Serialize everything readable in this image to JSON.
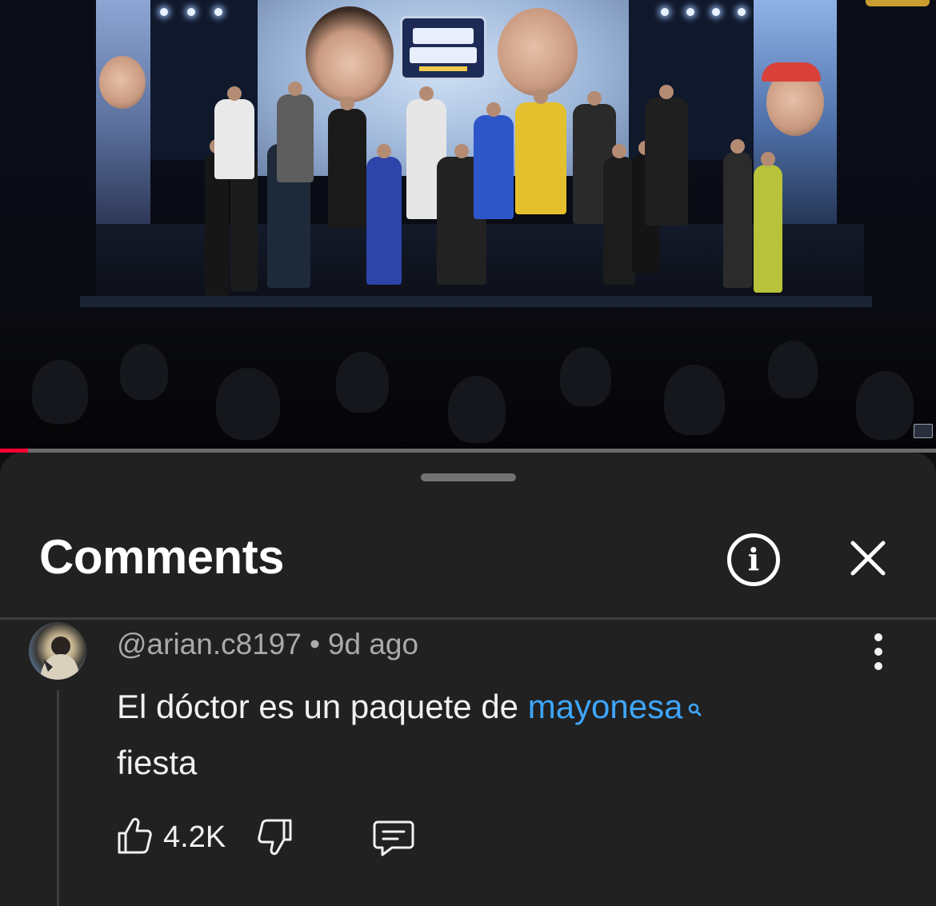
{
  "video": {
    "progress_fraction": 0.03
  },
  "comments_panel": {
    "title": "Comments",
    "info_icon": "info-circle-icon",
    "close_icon": "close-icon"
  },
  "comment": {
    "author": "@arian.c8197",
    "separator": "•",
    "time": "9d ago",
    "text_before": "El dóctor es un paquete de ",
    "search_term": "mayonesa",
    "text_after": "fiesta",
    "like_count": "4.2K",
    "like_icon": "thumbs-up-icon",
    "dislike_icon": "thumbs-down-icon",
    "reply_icon": "reply-comment-icon",
    "more_icon": "more-vertical-icon"
  },
  "colors": {
    "background": "#0f0f0f",
    "sheet": "#212121",
    "link": "#3ea6ff",
    "progress": "#ff0033",
    "muted_text": "#aaaaaa"
  }
}
